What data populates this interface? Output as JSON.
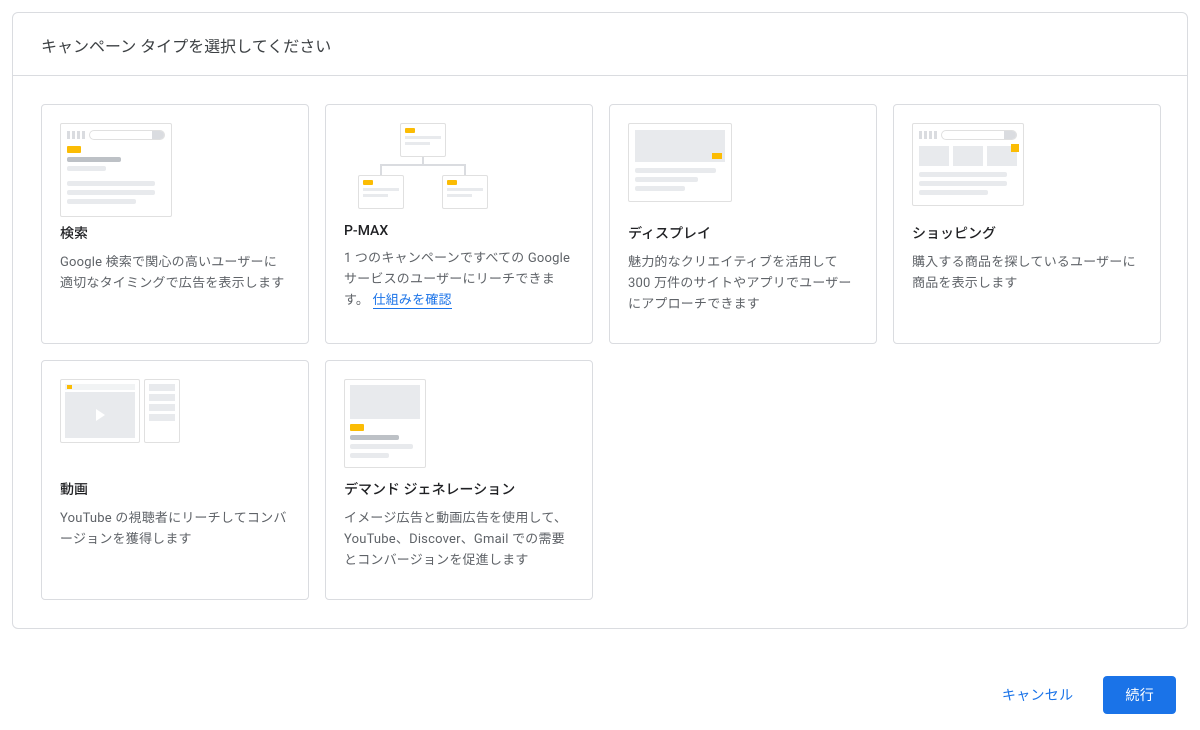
{
  "header": {
    "title": "キャンペーン タイプを選択してください"
  },
  "cards": {
    "search": {
      "title": "検索",
      "desc": "Google 検索で関心の高いユーザーに適切なタイミングで広告を表示します"
    },
    "pmax": {
      "title": "P-MAX",
      "desc": "1 つのキャンペーンですべての Google サービスのユーザーにリーチできます。 ",
      "link": "仕組みを確認"
    },
    "display": {
      "title": "ディスプレイ",
      "desc": "魅力的なクリエイティブを活用して 300 万件のサイトやアプリでユーザーにアプローチできます"
    },
    "shopping": {
      "title": "ショッピング",
      "desc": "購入する商品を探しているユーザーに商品を表示します"
    },
    "video": {
      "title": "動画",
      "desc": "YouTube の視聴者にリーチしてコンバージョンを獲得します"
    },
    "demand": {
      "title": "デマンド ジェネレーション",
      "desc": "イメージ広告と動画広告を使用して、YouTube、Discover、Gmail での需要とコンバージョンを促進します"
    }
  },
  "footer": {
    "cancel": "キャンセル",
    "continue": "続行"
  }
}
